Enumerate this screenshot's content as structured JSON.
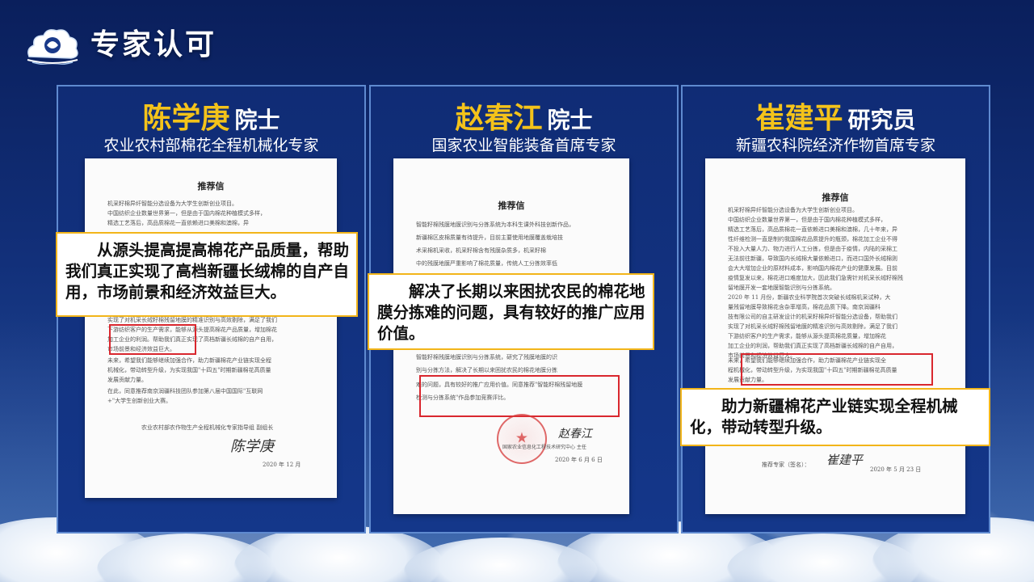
{
  "header": {
    "title": "专家认可",
    "logo_icon": "cotton-cloud-logo-icon"
  },
  "experts": [
    {
      "name": "陈学庚",
      "title": "院士",
      "role": "农业农村部棉花全程机械化专家",
      "quote": "从源头提高提高棉花产品质量，帮助我们真正实现了高档新疆长绒棉的自产自用，市场前景和经济效益巨大。",
      "letter": {
        "heading": "推荐信",
        "lines": [
          "机采籽棉异纤智能分选设备为大学生创新创业项目。",
          "中国纺织企业数量世界第一，但是由于国内棉花种植模式多样，",
          "精选工艺落后，高品质棉花一直依赖进口美棉和澳棉，异",
          "实现了对机采长绒籽棉残留地膜的精准识别与高效剔除，满足了我们",
          "下游纺织客户的生产需求，能够从源头提高棉花产品质量，增加棉花",
          "加工企业的利润。帮助我们真正实现了高档新疆长绒棉的自产自用，",
          "市场前景和经济效益巨大。",
          "未来，希望我们能够继续加强合作，助力新疆棉花产业链实现全程",
          "机械化，带动转型升级，为实现我国\"十四五\"时期新疆棉花高质量",
          "发展贡献力量。",
          "在此，同意推荐南京润疆科技团队参加第八届中国国际\"互联网",
          "+\"大学生创新创业大赛。"
        ],
        "signer": "农业农村部农作物生产全程机械化专家指导组  副组长",
        "signature": "陈学庚",
        "date": "2020 年 12 月"
      }
    },
    {
      "name": "赵春江",
      "title": "院士",
      "role": "国家农业智能装备首席专家",
      "quote": "解决了长期以来困扰农民的棉花地膜分拣难的问题，具有较好的推广应用价值。",
      "letter": {
        "heading": "推荐信",
        "lines": [
          "智能籽棉残膜地膜识别与分拣系统为本科生课外科技创新作品，",
          "新疆棉区皮棉质量有待提升，目前主要使用地膜覆盖栽培技",
          "术采棉机采收，机采籽棉含有残膜杂质多，机采籽棉",
          "中的残膜地膜严重影响了棉花质量，传统人工分拣效率低",
          "智能籽棉残膜地膜识别与分拣系统，研究了残膜地膜的识",
          "别与分拣方法，解决了长期以来困扰农民的棉花地膜分拣",
          "难的问题，具有较好的推广应用价值。同意推荐\"智能籽棉残留地膜",
          "检测与分拣系统\"作品参加竞赛评比。"
        ],
        "signer": "国家农业信息化工程技术研究中心  主任",
        "signature": "赵春江",
        "date": "2020 年 6 月 6 日"
      }
    },
    {
      "name": "崔建平",
      "title": "研究员",
      "role": "新疆农科院经济作物首席专家",
      "quote": "助力新疆棉花产业链实现全程机械化，带动转型升级。",
      "letter": {
        "heading": "推荐信",
        "lines": [
          "机采籽棉异纤智能分选设备为大学生创新创业项目。",
          "中国纺织企业数量世界第一，但是由于国内棉花种植模式多样，",
          "精选工艺落后，高品质棉花一直依赖进口美棉和澳棉，几十年来，异",
          "性纤维检测一直是制约我国棉花品质提升的瓶颈，棉花加工企业不得",
          "不投入大量人力、物力进行人工分拣，但是由于疫情，内陆的采棉工",
          "无法前往新疆，导致国内长绒棉大量依赖进口，而进口国外长绒棉则",
          "会大大增加企业的原材料成本，影响国内棉花产业的健康发展。目前",
          "疫情复发以来，棉花进口难度加大，因此我们急需针对机采长绒籽棉残",
          "留地膜开发一套地膜智能识别与分拣系统。",
          "2020 年 11 月份，新疆农业科学院首次突破长绒棉机采试种，大",
          "量残留地膜导致棉花含杂率增高，棉花品质下降。南京润疆科",
          "技有限公司的自主研发设计的机采籽棉异纤智能分选设备，帮助我们",
          "实现了对机采长绒籽棉残留地膜的精准识别与高效剔除，满足了我们",
          "下游纺织客户的生产需求，能够从源头提高棉花质量，增加棉花",
          "加工企业的利润，帮助我们真正实现了高档新疆长绒棉的自产自用，",
          "市场前景和经济效益巨大。",
          "未来，希望我们能够继续加强合作，助力新疆棉花产业链实现全",
          "程机械化，带动转型升级，为实现我国\"十四五\"时期新疆棉花高质量",
          "发展贡献力量。"
        ],
        "signer": "推荐专家（签名）：",
        "signature": "崔建平",
        "date": "2020 年 5 月 23 日"
      }
    }
  ],
  "colors": {
    "name_gold": "#f4c31a",
    "card_border": "#5f8ad0",
    "highlight_red": "#d9272e",
    "quote_border": "#f2b51a"
  }
}
